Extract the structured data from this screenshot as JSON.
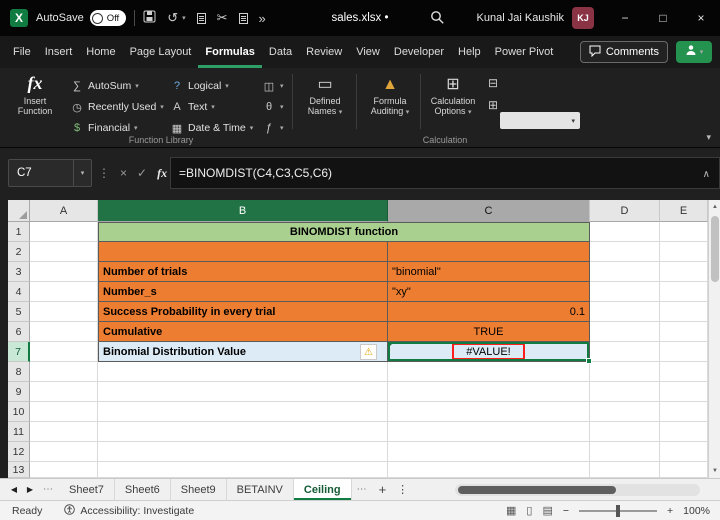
{
  "colors": {
    "excel_green": "#107C41",
    "table_orange": "#ED7D31",
    "title_green": "#A9D08E",
    "result_blue": "#DDEBF7",
    "error_annotation_red": "#FF1F1F",
    "avatar_maroon": "#8A3344"
  },
  "icons": {
    "excel-logo": "X",
    "caret-down-icon": "▾",
    "undo-icon": "↺",
    "cut-icon": "✂",
    "overflow-chevron-icon": "»",
    "minimize-icon": "−",
    "maximize-icon": "□",
    "close-icon": "×",
    "cancel-icon": "×",
    "enter-icon": "✓",
    "fx-icon": "fx",
    "expand-formula-bar-icon": "∧",
    "kebab-icon": "⋮",
    "autosum-icon": "∑",
    "recently-used-icon": "◷",
    "financial-icon": "$",
    "logical-icon": "?",
    "text-icon": "A",
    "datetime-icon": "▦",
    "lookup-icon": "◫",
    "math-icon": "θ",
    "more-functions-icon": "ƒ",
    "defined-names-icon": "▭",
    "formula-auditing-icon": "▲",
    "calculation-options-icon": "⊞",
    "calc-now-icon": "⊟",
    "calc-sheet-icon": "⊞",
    "warning-icon": "⚠",
    "sheet-prev-icon": "◀",
    "sheet-next-icon": "▶",
    "dots-icon": "⋯",
    "add-sheet-icon": "+",
    "normal-view-icon": "▦",
    "page-layout-view-icon": "▯",
    "page-break-view-icon": "▤",
    "zoom-out-icon": "−",
    "zoom-in-icon": "+",
    "scroll-up-icon": "▲",
    "scroll-down-icon": "▼"
  },
  "titlebar": {
    "autosave_label": "AutoSave",
    "autosave_state": "Off",
    "filename": "sales.xlsx",
    "modified_marker": "•",
    "user_name": "Kunal Jai Kaushik",
    "user_initials": "KJ"
  },
  "ribbon": {
    "tabs": [
      "File",
      "Insert",
      "Home",
      "Page Layout",
      "Formulas",
      "Data",
      "Review",
      "View",
      "Developer",
      "Help",
      "Power Pivot"
    ],
    "active_tab": "Formulas",
    "comments_label": "Comments",
    "function_library": {
      "label": "Function Library",
      "insert_function_label": "Insert Function",
      "col1": [
        {
          "icon": "autosum-icon",
          "label": "AutoSum"
        },
        {
          "icon": "recently-used-icon",
          "label": "Recently Used"
        },
        {
          "icon": "financial-icon",
          "label": "Financial"
        }
      ],
      "col2": [
        {
          "icon": "logical-icon",
          "label": "Logical"
        },
        {
          "icon": "text-icon",
          "label": "Text"
        },
        {
          "icon": "datetime-icon",
          "label": "Date & Time"
        }
      ],
      "col3": [
        {
          "icon": "lookup-icon"
        },
        {
          "icon": "math-icon"
        },
        {
          "icon": "more-functions-icon"
        }
      ]
    },
    "defined_names_label": "Defined Names",
    "formula_auditing_label": "Formula Auditing",
    "calculation_options_label": "Calculation Options",
    "calculation_label": "Calculation"
  },
  "formula_bar": {
    "name_box": "C7",
    "formula": "=BINOMDIST(C4,C3,C5,C6)"
  },
  "grid": {
    "col_headers": [
      "A",
      "B",
      "C",
      "D",
      "E"
    ],
    "rows_total": 13,
    "header_highlight": {
      "cols": {
        "B": "green",
        "C": "gray"
      },
      "row": 7
    },
    "selected_cell": "C7",
    "cells": {
      "1": [
        {
          "col": "B",
          "span": 2,
          "fill": "green",
          "bold": true,
          "align": "center",
          "text": "BINOMDIST function"
        }
      ],
      "2": [
        {
          "col": "B",
          "fill": "orange"
        },
        {
          "col": "C",
          "fill": "orange"
        }
      ],
      "3": [
        {
          "col": "B",
          "fill": "orange",
          "bold": true,
          "text": "Number of trials"
        },
        {
          "col": "C",
          "fill": "orange",
          "text": "\"binomial\""
        }
      ],
      "4": [
        {
          "col": "B",
          "fill": "orange",
          "bold": true,
          "text": "Number_s"
        },
        {
          "col": "C",
          "fill": "orange",
          "text": "\"xy\""
        }
      ],
      "5": [
        {
          "col": "B",
          "fill": "orange",
          "bold": true,
          "text": "Success Probability in every trial"
        },
        {
          "col": "C",
          "fill": "orange",
          "align": "right",
          "text": "0.1"
        }
      ],
      "6": [
        {
          "col": "B",
          "fill": "orange",
          "bold": true,
          "text": "Cumulative"
        },
        {
          "col": "C",
          "fill": "orange",
          "align": "center",
          "text": "TRUE"
        }
      ],
      "7": [
        {
          "col": "B",
          "fill": "blue",
          "bold": true,
          "text": "Binomial Distribution Value",
          "warning": true
        },
        {
          "col": "C",
          "fill": "blue",
          "align": "center",
          "text": "#VALUE!",
          "error_box": true,
          "selected": true
        }
      ]
    }
  },
  "sheet_bar": {
    "tabs": [
      "Sheet7",
      "Sheet6",
      "Sheet9",
      "BETAINV",
      "Ceiling"
    ],
    "active_tab": "Ceiling"
  },
  "status_bar": {
    "mode": "Ready",
    "accessibility": "Accessibility: Investigate",
    "zoom_level": "100%"
  }
}
